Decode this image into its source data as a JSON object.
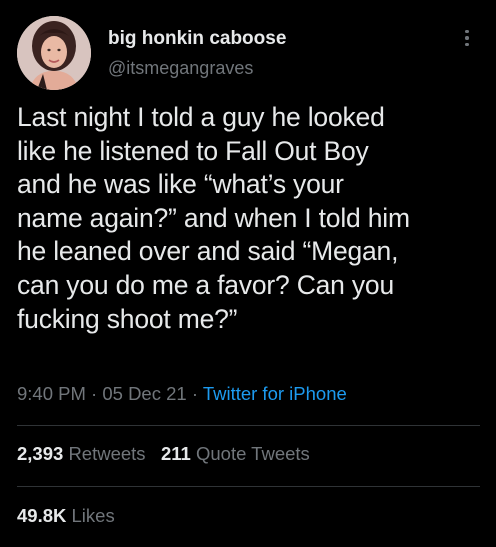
{
  "author": {
    "display_name": "big honkin caboose",
    "handle": "@itsmegangraves"
  },
  "tweet": {
    "text": "Last night I told a guy he looked\nlike he listened to Fall Out Boy\nand he was like “what’s your\nname again?” and when I told him\nhe leaned over and said “Megan,\ncan you do me a favor? Can you\nfucking shoot me?”",
    "time": "9:40 PM",
    "sep1": " · ",
    "date": "05 Dec 21",
    "sep2": " · ",
    "source": "Twitter for iPhone"
  },
  "stats": {
    "retweets_count": "2,393",
    "retweets_label": "Retweets",
    "quotes_count": "211",
    "quotes_label": "Quote Tweets",
    "likes_count": "49.8K",
    "likes_label": "Likes"
  },
  "icons": {
    "more": "more-vertical-icon"
  },
  "colors": {
    "background": "#000000",
    "text": "#e7e9ea",
    "secondary": "#71767b",
    "link": "#1d9bf0",
    "divider": "#2f3336"
  }
}
